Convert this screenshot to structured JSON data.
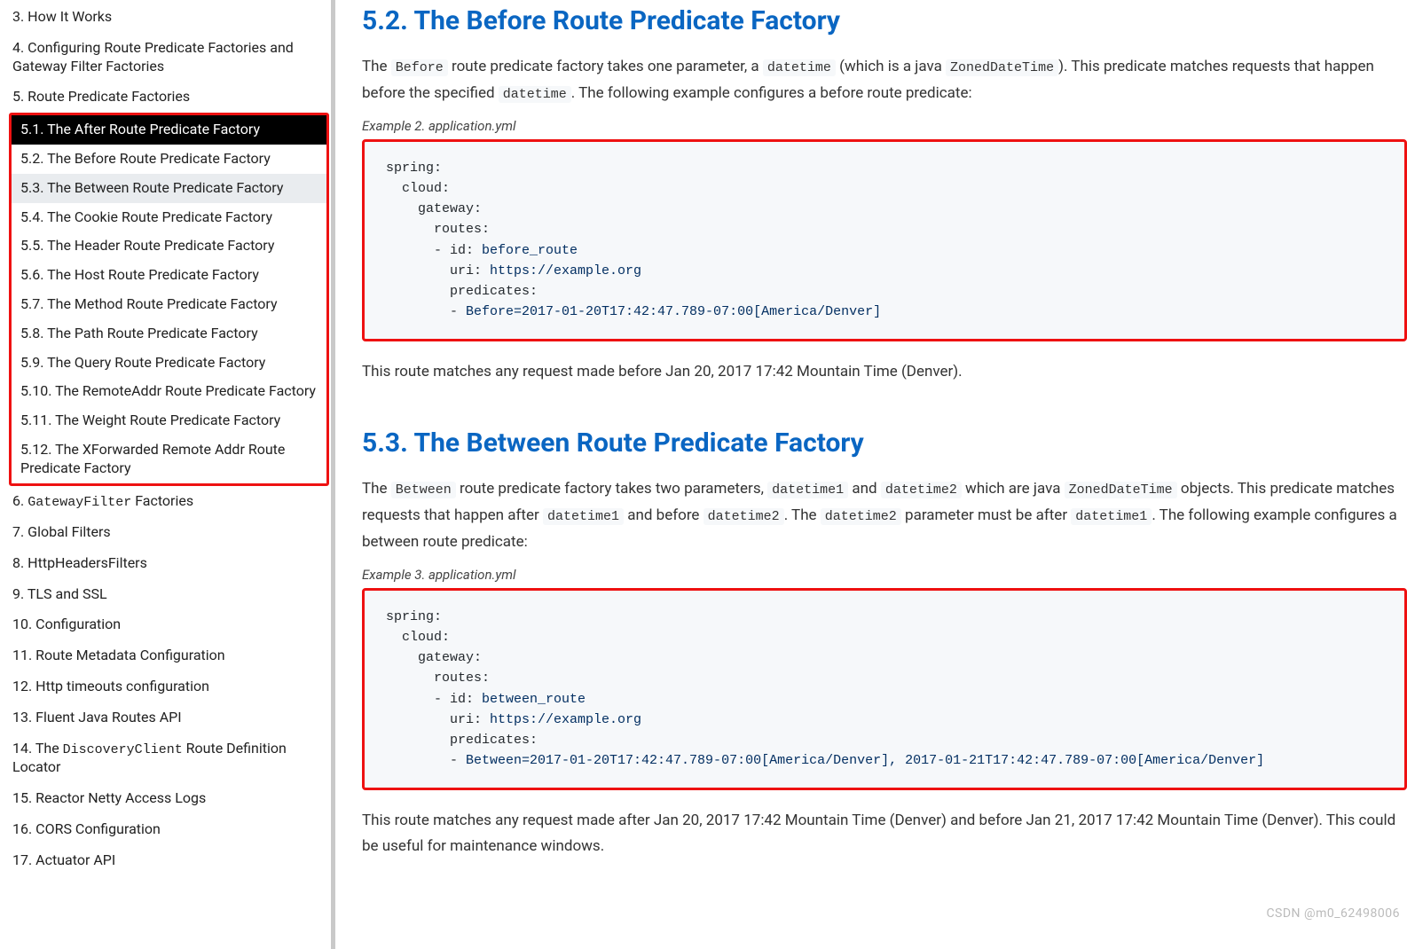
{
  "sidebar": {
    "top": [
      {
        "label": "3. How It Works"
      },
      {
        "label": "4. Configuring Route Predicate Factories and Gateway Filter Factories"
      },
      {
        "label": "5. Route Predicate Factories"
      }
    ],
    "sub": [
      {
        "label": "5.1. The After Route Predicate Factory",
        "selected": true
      },
      {
        "label": "5.2. The Before Route Predicate Factory"
      },
      {
        "label": "5.3. The Between Route Predicate Factory",
        "hover": true
      },
      {
        "label": "5.4. The Cookie Route Predicate Factory"
      },
      {
        "label": "5.5. The Header Route Predicate Factory"
      },
      {
        "label": "5.6. The Host Route Predicate Factory"
      },
      {
        "label": "5.7. The Method Route Predicate Factory"
      },
      {
        "label": "5.8. The Path Route Predicate Factory"
      },
      {
        "label": "5.9. The Query Route Predicate Factory"
      },
      {
        "label": "5.10. The RemoteAddr Route Predicate Factory"
      },
      {
        "label": "5.11. The Weight Route Predicate Factory"
      },
      {
        "label": "5.12. The XForwarded Remote Addr Route Predicate Factory"
      }
    ],
    "bottom": [
      {
        "pre": "6. ",
        "code": "GatewayFilter",
        "post": " Factories"
      },
      {
        "label": "7. Global Filters"
      },
      {
        "label": "8. HttpHeadersFilters"
      },
      {
        "label": "9. TLS and SSL"
      },
      {
        "label": "10. Configuration"
      },
      {
        "label": "11. Route Metadata Configuration"
      },
      {
        "label": "12. Http timeouts configuration"
      },
      {
        "label": "13. Fluent Java Routes API"
      },
      {
        "pre": "14. The ",
        "code": "DiscoveryClient",
        "post": " Route Definition Locator"
      },
      {
        "label": "15. Reactor Netty Access Logs"
      },
      {
        "label": "16. CORS Configuration"
      },
      {
        "label": "17. Actuator API"
      }
    ]
  },
  "section52": {
    "title": "5.2. The Before Route Predicate Factory",
    "p1a": "The ",
    "p1_code1": "Before",
    "p1b": " route predicate factory takes one parameter, a ",
    "p1_code2": "datetime",
    "p1c": " (which is a java ",
    "p1_code3": "ZonedDateTime",
    "p1d": "). This predicate matches requests that happen before the specified ",
    "p1_code4": "datetime",
    "p1e": ". The following example configures a before route predicate:",
    "example_label": "Example 2. application.yml",
    "code": {
      "l1": "spring:",
      "l2": "  cloud:",
      "l3": "    gateway:",
      "l4": "      routes:",
      "l5a": "      - id: ",
      "l5b": "before_route",
      "l6a": "        uri: ",
      "l6b": "https://example.org",
      "l7": "        predicates:",
      "l8a": "        - ",
      "l8b": "Before=2017-01-20T17:42:47.789-07:00[America/Denver]"
    },
    "p2": "This route matches any request made before Jan 20, 2017 17:42 Mountain Time (Denver)."
  },
  "section53": {
    "title": "5.3. The Between Route Predicate Factory",
    "p1a": "The ",
    "p1_code1": "Between",
    "p1b": " route predicate factory takes two parameters, ",
    "p1_code2": "datetime1",
    "p1c": " and ",
    "p1_code3": "datetime2",
    "p1d": " which are java ",
    "p1_code4": "ZonedDateTime",
    "p1e": " objects. This predicate matches requests that happen after ",
    "p1_code5": "datetime1",
    "p1f": " and before ",
    "p1_code6": "datetime2",
    "p1g": ". The ",
    "p1_code7": "datetime2",
    "p1h": " parameter must be after ",
    "p1_code8": "datetime1",
    "p1i": ". The following example configures a between route predicate:",
    "example_label": "Example 3. application.yml",
    "code": {
      "l1": "spring:",
      "l2": "  cloud:",
      "l3": "    gateway:",
      "l4": "      routes:",
      "l5a": "      - id: ",
      "l5b": "between_route",
      "l6a": "        uri: ",
      "l6b": "https://example.org",
      "l7": "        predicates:",
      "l8a": "        - ",
      "l8b": "Between=2017-01-20T17:42:47.789-07:00[America/Denver],",
      "l8c": " 2017-01-21T17:42:47.789-07:00[America/Denver]"
    },
    "p2": "This route matches any request made after Jan 20, 2017 17:42 Mountain Time (Denver) and before Jan 21, 2017 17:42 Mountain Time (Denver). This could be useful for maintenance windows."
  },
  "watermark": "CSDN @m0_62498006"
}
